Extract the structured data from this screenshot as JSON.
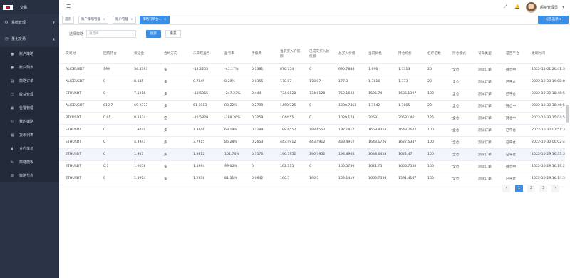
{
  "app": {
    "logo_text": "交易"
  },
  "sidebar": {
    "groups": [
      {
        "label": "系统管理",
        "icon": "gear-icon"
      },
      {
        "label": "量化交易",
        "icon": "chart-icon"
      }
    ],
    "items": [
      {
        "label": "账户策略",
        "icon": "user-icon"
      },
      {
        "label": "账户列表",
        "icon": "users-icon"
      },
      {
        "label": "策略订单",
        "icon": "order-icon"
      },
      {
        "label": "收益管理",
        "icon": "money-icon"
      },
      {
        "label": "告警管理",
        "icon": "alert-icon"
      },
      {
        "label": "我的策略",
        "icon": "refresh-icon"
      },
      {
        "label": "货币列表",
        "icon": "coin-icon"
      },
      {
        "label": "合约单位",
        "icon": "bar-icon"
      },
      {
        "label": "策略模板",
        "icon": "template-icon"
      },
      {
        "label": "策略节点",
        "icon": "list-icon"
      }
    ]
  },
  "header": {
    "username": "超级管理员"
  },
  "tags": {
    "items": [
      {
        "label": "首页"
      },
      {
        "label": "账户策略管理"
      },
      {
        "label": "账户管理"
      },
      {
        "label": "策略订单合..."
      }
    ],
    "option_label": "标签选项"
  },
  "filter": {
    "label": "选择策略",
    "select_placeholder": "请选择",
    "search_label": "搜索",
    "reset_label": "重置"
  },
  "table": {
    "columns": [
      "交易对",
      "回购持仓",
      "保证金",
      "合约方向",
      "未实现盈亏",
      "盈亏率",
      "手续费",
      "当前买入价值额",
      "已成交买入价值额",
      "总买入价值",
      "当前价格",
      "持仓均价",
      "杠杆倍数",
      "持仓模式",
      "订单类型",
      "是否平仓",
      "更新时间"
    ],
    "rows": [
      [
        "ALICEUSDT",
        "399",
        "34.5393",
        "多",
        "-14.2205",
        "-41.17%",
        "0.1381",
        "876.754",
        "0",
        "690.7884",
        "1.696",
        "1.7313",
        "20",
        "全仓",
        "测试订单",
        "持仓中",
        "2022-11-01 20:41:33"
      ],
      [
        "ALICEUSDT",
        "0",
        "8.885",
        "多",
        "0.7345",
        "8.29%",
        "0.0355",
        "178.07",
        "178.07",
        "177.3",
        "1.7816",
        "1.773",
        "20",
        "全仓",
        "测试订单",
        "已平仓",
        "2022-10-30 19:08:06"
      ],
      [
        "ETHUSDT",
        "0",
        "7.5216",
        "多",
        "-18.5955",
        "-247.23%",
        "0.444",
        "734.0128",
        "734.0128",
        "752.1643",
        "1595.74",
        "1635.1397",
        "100",
        "全仓",
        "测试订单",
        "已平仓",
        "2022-10-30 18:46:57"
      ],
      [
        "ALICEUSDT",
        "818.7",
        "69.9373",
        "多",
        "61.6983",
        "88.22%",
        "0.2799",
        "1460.725",
        "0",
        "1398.7458",
        "1.7842",
        "1.7085",
        "20",
        "全仓",
        "测试订单",
        "持仓中",
        "2022-10-30 18:46:54"
      ],
      [
        "BTCUSDT",
        "0.05",
        "8.2334",
        "空",
        "-15.5829",
        "-189.26%",
        "0.2059",
        "1044.55",
        "0",
        "1029.173",
        "20691",
        "20583.46",
        "125",
        "全仓",
        "测试订单",
        "持仓中",
        "2022-10-30 15:04:54"
      ],
      [
        "ETHUSDT",
        "0",
        "1.9719",
        "多",
        "1.3446",
        "68.19%",
        "0.1189",
        "198.6552",
        "198.6552",
        "197.1817",
        "1659.8354",
        "1643.2642",
        "100",
        "全仓",
        "测试订单",
        "已平仓",
        "2022-10-30 01:51:36"
      ],
      [
        "ETHUSDT",
        "0",
        "4.3943",
        "多",
        "3.7915",
        "86.28%",
        "0.2653",
        "443.4912",
        "443.4912",
        "439.4912",
        "1643.1726",
        "1627.5347",
        "100",
        "全仓",
        "测试订单",
        "已平仓",
        "2022-10-30 00:02:48"
      ],
      [
        "ETHUSDT",
        "0",
        "1.947",
        "多",
        "1.9812",
        "101.76%",
        "0.1176",
        "196.7952",
        "196.7952",
        "194.8964",
        "1638.6458",
        "1622.47",
        "100",
        "全仓",
        "测试订单",
        "已平仓",
        "2022-10-29 16:33:39"
      ],
      [
        "ETHUSDT",
        "0.1",
        "1.6058",
        "多",
        "1.5994",
        "99.60%",
        "0",
        "162.175",
        "0",
        "160.5756",
        "1621.75",
        "1605.7556",
        "100",
        "全仓",
        "测试订单",
        "持仓中",
        "2022-10-29 16:19:24"
      ],
      [
        "ETHUSDT",
        "0",
        "1.5914",
        "多",
        "1.2938",
        "81.31%",
        "0.0642",
        "160.5",
        "160.5",
        "159.1419",
        "1605.7556",
        "1591.4167",
        "100",
        "全仓",
        "测试订单",
        "已平仓",
        "2022-10-29 16:14:51"
      ]
    ]
  },
  "pagination": {
    "prev_symbol": "‹",
    "pages": [
      "1",
      "2",
      "3"
    ],
    "next_symbol": "›",
    "current": "1"
  },
  "colors": {
    "accent": "#3a8ee6",
    "sidebar_bg": "#2b3447"
  }
}
